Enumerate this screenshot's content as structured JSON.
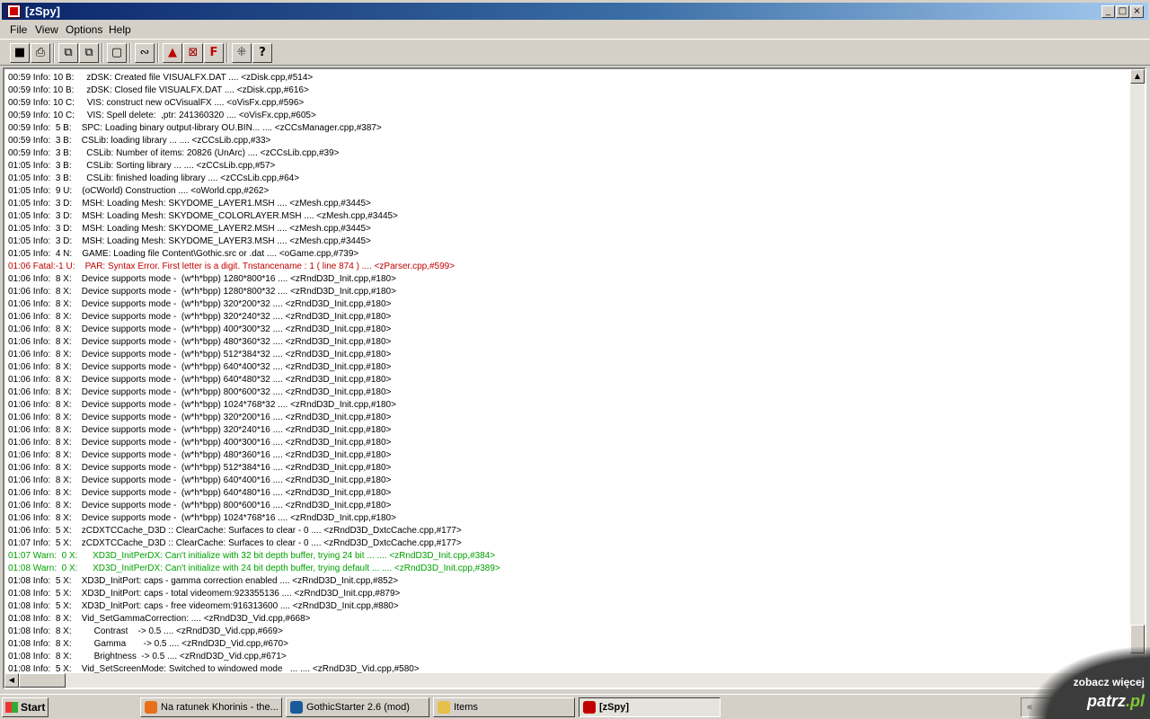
{
  "window": {
    "title": "[zSpy]",
    "controls": {
      "minimize": "_",
      "maximize": "□",
      "close": "×"
    }
  },
  "menu": [
    "File",
    "View",
    "Options",
    "Help"
  ],
  "toolbar": {
    "icons": [
      "save-icon",
      "print-icon",
      "copy-icon",
      "paste-icon",
      "new-document-icon",
      "connect-icon",
      "move-up-icon",
      "clear-icon",
      "filter-icon",
      "chart-icon",
      "help-icon"
    ],
    "glyphs": {
      "save": "■",
      "print": "⎙",
      "copy": "⧉",
      "paste": "⧉",
      "new": "▢",
      "connect": "∾",
      "up": "▲",
      "clear": "⊠",
      "filter": "F",
      "chart": "⁜",
      "help": "?"
    }
  },
  "log": {
    "colors": {
      "normal": "#000000",
      "fatal": "#c00000",
      "warn": "#00a000"
    },
    "lines": [
      {
        "level": "info",
        "text": "00:59 Info: 10 B:     zDSK: Created file VISUALFX.DAT .... <zDisk.cpp,#514>"
      },
      {
        "level": "info",
        "text": "00:59 Info: 10 B:     zDSK: Closed file VISUALFX.DAT .... <zDisk.cpp,#616>"
      },
      {
        "level": "info",
        "text": "00:59 Info: 10 C:     VIS: construct new oCVisualFX .... <oVisFx.cpp,#596>"
      },
      {
        "level": "info",
        "text": "00:59 Info: 10 C:     VIS: Spell delete:  ,ptr: 241360320 .... <oVisFx.cpp,#605>"
      },
      {
        "level": "info",
        "text": "00:59 Info:  5 B:    SPC: Loading binary output-library OU.BIN... .... <zCCsManager.cpp,#387>"
      },
      {
        "level": "info",
        "text": "00:59 Info:  3 B:    CSLib: loading library ... .... <zCCsLib.cpp,#33>"
      },
      {
        "level": "info",
        "text": "00:59 Info:  3 B:      CSLib: Number of items: 20826 (UnArc) .... <zCCsLib.cpp,#39>"
      },
      {
        "level": "info",
        "text": "01:05 Info:  3 B:      CSLib: Sorting library ... .... <zCCsLib.cpp,#57>"
      },
      {
        "level": "info",
        "text": "01:05 Info:  3 B:      CSLib: finished loading library .... <zCCsLib.cpp,#64>"
      },
      {
        "level": "info",
        "text": "01:05 Info:  9 U:    (oCWorld) Construction .... <oWorld.cpp,#262>"
      },
      {
        "level": "info",
        "text": "01:05 Info:  3 D:    MSH: Loading Mesh: SKYDOME_LAYER1.MSH .... <zMesh.cpp,#3445>"
      },
      {
        "level": "info",
        "text": "01:05 Info:  3 D:    MSH: Loading Mesh: SKYDOME_COLORLAYER.MSH .... <zMesh.cpp,#3445>"
      },
      {
        "level": "info",
        "text": "01:05 Info:  3 D:    MSH: Loading Mesh: SKYDOME_LAYER2.MSH .... <zMesh.cpp,#3445>"
      },
      {
        "level": "info",
        "text": "01:05 Info:  3 D:    MSH: Loading Mesh: SKYDOME_LAYER3.MSH .... <zMesh.cpp,#3445>"
      },
      {
        "level": "info",
        "text": "01:05 Info:  4 N:    GAME: Loading file Content\\Gothic.src or .dat .... <oGame.cpp,#739>"
      },
      {
        "level": "fatal",
        "text": "01:06 Fatal:-1 U:    PAR: Syntax Error. First letter is a digit. Tnstancename : 1 ( line 874 ) .... <zParser.cpp,#599>"
      },
      {
        "level": "info",
        "text": "01:06 Info:  8 X:    Device supports mode -  (w*h*bpp) 1280*800*16 .... <zRndD3D_Init.cpp,#180>"
      },
      {
        "level": "info",
        "text": "01:06 Info:  8 X:    Device supports mode -  (w*h*bpp) 1280*800*32 .... <zRndD3D_Init.cpp,#180>"
      },
      {
        "level": "info",
        "text": "01:06 Info:  8 X:    Device supports mode -  (w*h*bpp) 320*200*32 .... <zRndD3D_Init.cpp,#180>"
      },
      {
        "level": "info",
        "text": "01:06 Info:  8 X:    Device supports mode -  (w*h*bpp) 320*240*32 .... <zRndD3D_Init.cpp,#180>"
      },
      {
        "level": "info",
        "text": "01:06 Info:  8 X:    Device supports mode -  (w*h*bpp) 400*300*32 .... <zRndD3D_Init.cpp,#180>"
      },
      {
        "level": "info",
        "text": "01:06 Info:  8 X:    Device supports mode -  (w*h*bpp) 480*360*32 .... <zRndD3D_Init.cpp,#180>"
      },
      {
        "level": "info",
        "text": "01:06 Info:  8 X:    Device supports mode -  (w*h*bpp) 512*384*32 .... <zRndD3D_Init.cpp,#180>"
      },
      {
        "level": "info",
        "text": "01:06 Info:  8 X:    Device supports mode -  (w*h*bpp) 640*400*32 .... <zRndD3D_Init.cpp,#180>"
      },
      {
        "level": "info",
        "text": "01:06 Info:  8 X:    Device supports mode -  (w*h*bpp) 640*480*32 .... <zRndD3D_Init.cpp,#180>"
      },
      {
        "level": "info",
        "text": "01:06 Info:  8 X:    Device supports mode -  (w*h*bpp) 800*600*32 .... <zRndD3D_Init.cpp,#180>"
      },
      {
        "level": "info",
        "text": "01:06 Info:  8 X:    Device supports mode -  (w*h*bpp) 1024*768*32 .... <zRndD3D_Init.cpp,#180>"
      },
      {
        "level": "info",
        "text": "01:06 Info:  8 X:    Device supports mode -  (w*h*bpp) 320*200*16 .... <zRndD3D_Init.cpp,#180>"
      },
      {
        "level": "info",
        "text": "01:06 Info:  8 X:    Device supports mode -  (w*h*bpp) 320*240*16 .... <zRndD3D_Init.cpp,#180>"
      },
      {
        "level": "info",
        "text": "01:06 Info:  8 X:    Device supports mode -  (w*h*bpp) 400*300*16 .... <zRndD3D_Init.cpp,#180>"
      },
      {
        "level": "info",
        "text": "01:06 Info:  8 X:    Device supports mode -  (w*h*bpp) 480*360*16 .... <zRndD3D_Init.cpp,#180>"
      },
      {
        "level": "info",
        "text": "01:06 Info:  8 X:    Device supports mode -  (w*h*bpp) 512*384*16 .... <zRndD3D_Init.cpp,#180>"
      },
      {
        "level": "info",
        "text": "01:06 Info:  8 X:    Device supports mode -  (w*h*bpp) 640*400*16 .... <zRndD3D_Init.cpp,#180>"
      },
      {
        "level": "info",
        "text": "01:06 Info:  8 X:    Device supports mode -  (w*h*bpp) 640*480*16 .... <zRndD3D_Init.cpp,#180>"
      },
      {
        "level": "info",
        "text": "01:06 Info:  8 X:    Device supports mode -  (w*h*bpp) 800*600*16 .... <zRndD3D_Init.cpp,#180>"
      },
      {
        "level": "info",
        "text": "01:06 Info:  8 X:    Device supports mode -  (w*h*bpp) 1024*768*16 .... <zRndD3D_Init.cpp,#180>"
      },
      {
        "level": "info",
        "text": "01:06 Info:  5 X:    zCDXTCCache_D3D :: ClearCache: Surfaces to clear - 0 .... <zRndD3D_DxtcCache.cpp,#177>"
      },
      {
        "level": "info",
        "text": "01:07 Info:  5 X:    zCDXTCCache_D3D :: ClearCache: Surfaces to clear - 0 .... <zRndD3D_DxtcCache.cpp,#177>"
      },
      {
        "level": "warn",
        "text": "01:07 Warn:  0 X:      XD3D_InitPerDX: Can't initialize with 32 bit depth buffer, trying 24 bit ... .... <zRndD3D_Init.cpp,#384>"
      },
      {
        "level": "warn",
        "text": "01:08 Warn:  0 X:      XD3D_InitPerDX: Can't initialize with 24 bit depth buffer, trying default ... .... <zRndD3D_Init.cpp,#389>"
      },
      {
        "level": "info",
        "text": "01:08 Info:  5 X:    XD3D_InitPort: caps - gamma correction enabled .... <zRndD3D_Init.cpp,#852>"
      },
      {
        "level": "info",
        "text": "01:08 Info:  5 X:    XD3D_InitPort: caps - total videomem:923355136 .... <zRndD3D_Init.cpp,#879>"
      },
      {
        "level": "info",
        "text": "01:08 Info:  5 X:    XD3D_InitPort: caps - free videomem:916313600 .... <zRndD3D_Init.cpp,#880>"
      },
      {
        "level": "info",
        "text": "01:08 Info:  8 X:    Vid_SetGammaCorrection: .... <zRndD3D_Vid.cpp,#668>"
      },
      {
        "level": "info",
        "text": "01:08 Info:  8 X:         Contrast    -> 0.5 .... <zRndD3D_Vid.cpp,#669>"
      },
      {
        "level": "info",
        "text": "01:08 Info:  8 X:         Gamma       -> 0.5 .... <zRndD3D_Vid.cpp,#670>"
      },
      {
        "level": "info",
        "text": "01:08 Info:  8 X:         Brightness  -> 0.5 .... <zRndD3D_Vid.cpp,#671>"
      },
      {
        "level": "info",
        "text": "01:08 Info:  5 X:    Vid_SetScreenMode: Switched to windowed mode   ... .... <zRndD3D_Vid.cpp,#580>"
      }
    ]
  },
  "scrollbars": {
    "up": "▲",
    "down": "▼",
    "left": "◀",
    "right": "▶"
  },
  "taskbar": {
    "start_label": "Start",
    "tasks": [
      {
        "label": "Na ratunek Khorinis - the...",
        "icon": "firefox-icon",
        "color": "#e8701a",
        "active": false
      },
      {
        "label": "GothicStarter 2.6 (mod)",
        "icon": "gothic-g-icon",
        "color": "#1a5a9a",
        "active": false
      },
      {
        "label": "Items",
        "icon": "folder-icon",
        "color": "#e6c04a",
        "active": false
      },
      {
        "label": "[zSpy]",
        "icon": "zspy-icon",
        "color": "#c00000",
        "active": true
      }
    ],
    "tray_label": "«"
  },
  "watermark": {
    "line1": "zobacz więcej",
    "line2_a": "patrz",
    "line2_b": ".pl"
  }
}
